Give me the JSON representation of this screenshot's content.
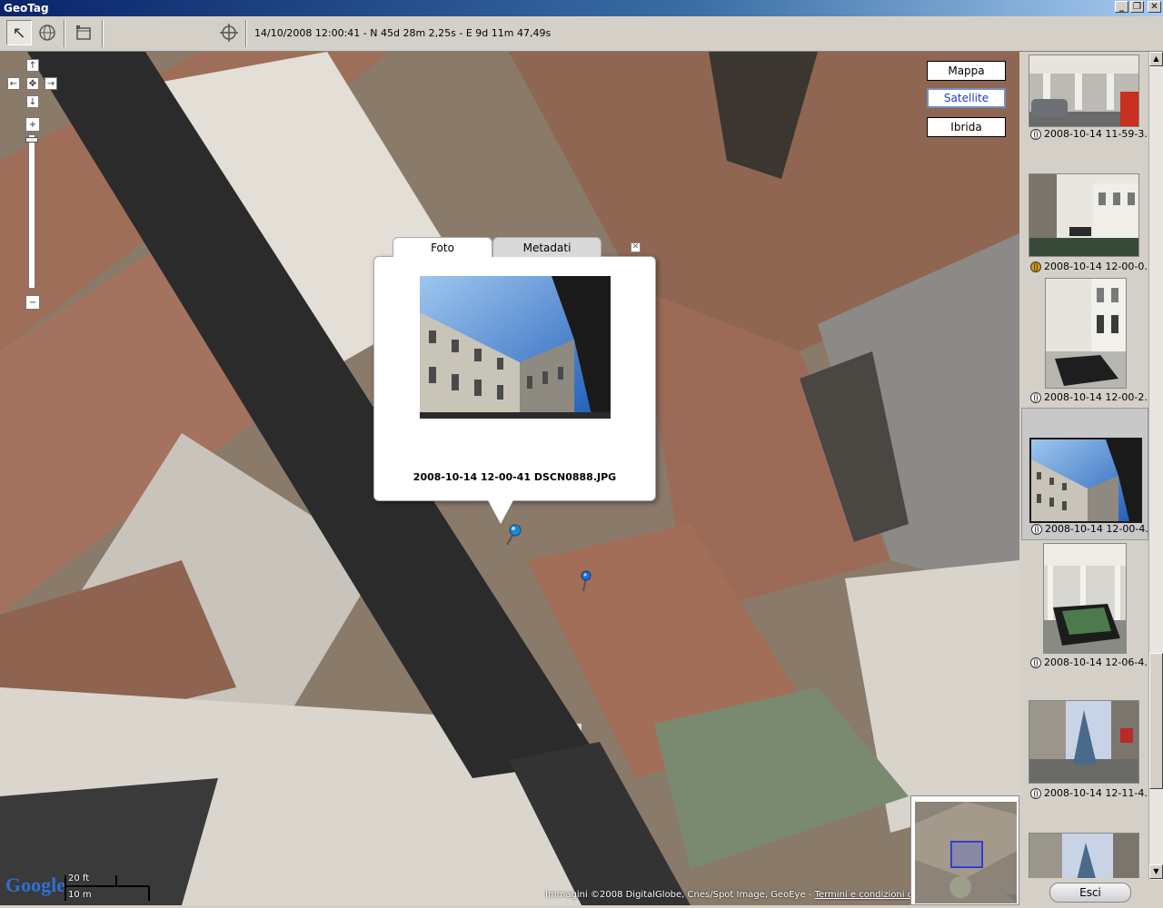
{
  "window": {
    "title": "GeoTag",
    "controls": {
      "minimize": "_",
      "restore": "❐",
      "close": "✕"
    }
  },
  "toolbar": {
    "tools": [
      {
        "icon": "select-arrow-icon",
        "glyph": "↖",
        "active": true
      },
      {
        "icon": "globe-icon",
        "glyph": "🌐",
        "active": false
      },
      {
        "icon": "window-icon",
        "glyph": "▭",
        "active": false
      },
      {
        "icon": "crosshair-icon",
        "glyph": "⌖",
        "active": false
      }
    ],
    "coordinates": "14/10/2008 12:00:41 - N 45d 28m 2,25s - E 9d 11m 47,49s"
  },
  "map": {
    "types": [
      {
        "label": "Mappa",
        "selected": false
      },
      {
        "label": "Satellite",
        "selected": true
      },
      {
        "label": "Ibrida",
        "selected": false
      }
    ],
    "pan": {
      "up": "↑",
      "left": "←",
      "center": "✥",
      "right": "→",
      "down": "↓"
    },
    "zoom": {
      "in": "+",
      "out": "−"
    },
    "popup": {
      "tabs": [
        "Foto",
        "Metadati"
      ],
      "active_tab": "Foto",
      "close": "✕",
      "caption": "2008-10-14 12-00-41 DSCN0888.JPG"
    },
    "logo": "Google",
    "scale": {
      "imperial": "20 ft",
      "metric": "10 m"
    },
    "attribution": "Immagini ©2008 DigitalGlobe, Cnes/Spot Image, GeoEye - ",
    "terms_link": "Termini e condizioni d'uso"
  },
  "thumbnails": [
    {
      "label": "2008-10-14 11-59-3...",
      "geotag": "globe-icon",
      "selected": false
    },
    {
      "label": "2008-10-14 12-00-0...",
      "geotag": "globe-gold-icon",
      "selected": false
    },
    {
      "label": "2008-10-14 12-00-2...",
      "geotag": "globe-icon",
      "selected": false
    },
    {
      "label": "2008-10-14 12-00-4...",
      "geotag": "globe-icon",
      "selected": true
    },
    {
      "label": "2008-10-14 12-06-4...",
      "geotag": "globe-icon",
      "selected": false
    },
    {
      "label": "2008-10-14 12-11-4...",
      "geotag": "globe-icon",
      "selected": false
    }
  ],
  "exit_button": "Esci",
  "colors": {
    "titlebar": "#0a246a",
    "selected_maptype_text": "#1f3dbf",
    "roof": "#9a6a55",
    "street": "#2b2b2b"
  }
}
